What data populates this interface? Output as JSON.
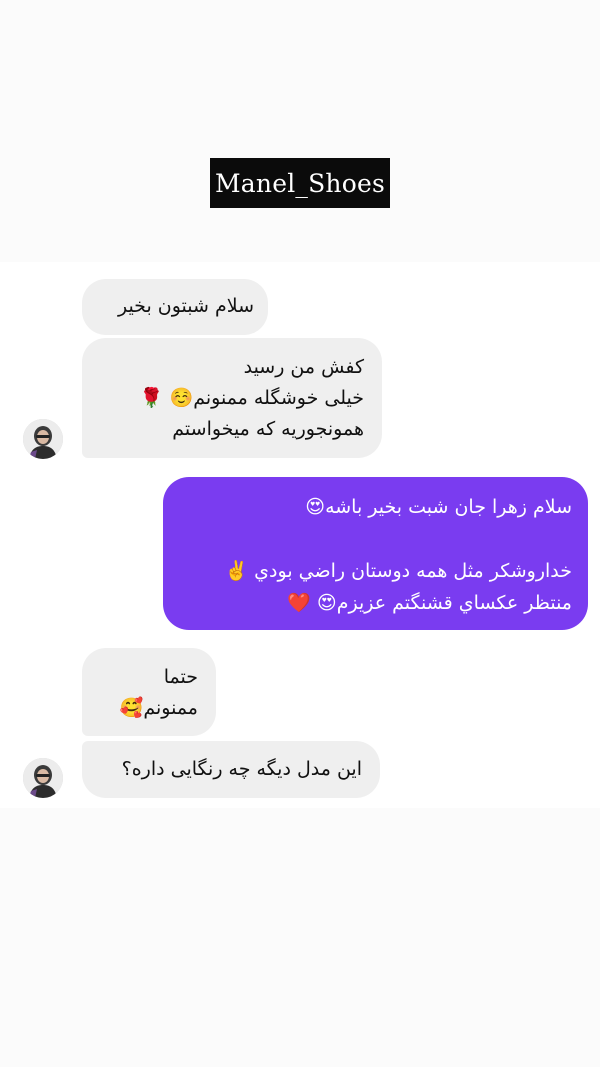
{
  "brand": {
    "label": "Manel_Shoes"
  },
  "messages": [
    {
      "side": "incoming",
      "lines": [
        "سلام شبتون بخیر"
      ]
    },
    {
      "side": "incoming",
      "lines": [
        "کفش من رسید",
        "خیلی خوشگله ممنونم☺️ 🌹",
        "همونجوریه که میخواستم"
      ]
    },
    {
      "side": "outgoing",
      "lines": [
        "سلام زهرا جان شبت بخير باشه😍",
        "",
        "خداروشكر مثل همه دوستان راضي بودي ✌️",
        "منتظر عكساي قشنگتم عزيزم😍 ❤️"
      ]
    },
    {
      "side": "incoming",
      "lines": [
        "حتما",
        "ممنونم🥰"
      ]
    },
    {
      "side": "incoming",
      "lines": [
        "این مدل دیگه چه رنگایی داره؟"
      ]
    }
  ],
  "avatar": {
    "icon": "user-avatar-icon"
  },
  "colors": {
    "outgoing_bubble": "#7a3cf0",
    "incoming_bubble": "#efefef",
    "brand_bg": "#0b0b0b"
  }
}
